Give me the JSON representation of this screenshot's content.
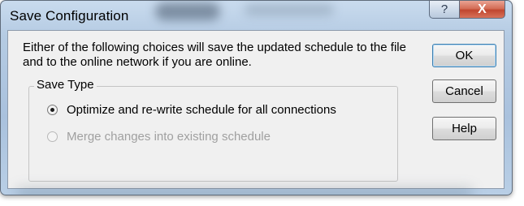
{
  "window": {
    "title": "Save Configuration",
    "help_glyph": "?",
    "close_glyph": "X"
  },
  "message": "Either of the following choices will save the updated schedule to the file and to the online network if you are online.",
  "save_type": {
    "legend": "Save Type",
    "options": [
      {
        "label": "Optimize and re-write schedule for all connections",
        "selected": true,
        "enabled": true
      },
      {
        "label": "Merge changes into existing schedule",
        "selected": false,
        "enabled": false
      }
    ]
  },
  "buttons": {
    "ok": "OK",
    "cancel": "Cancel",
    "help": "Help"
  }
}
